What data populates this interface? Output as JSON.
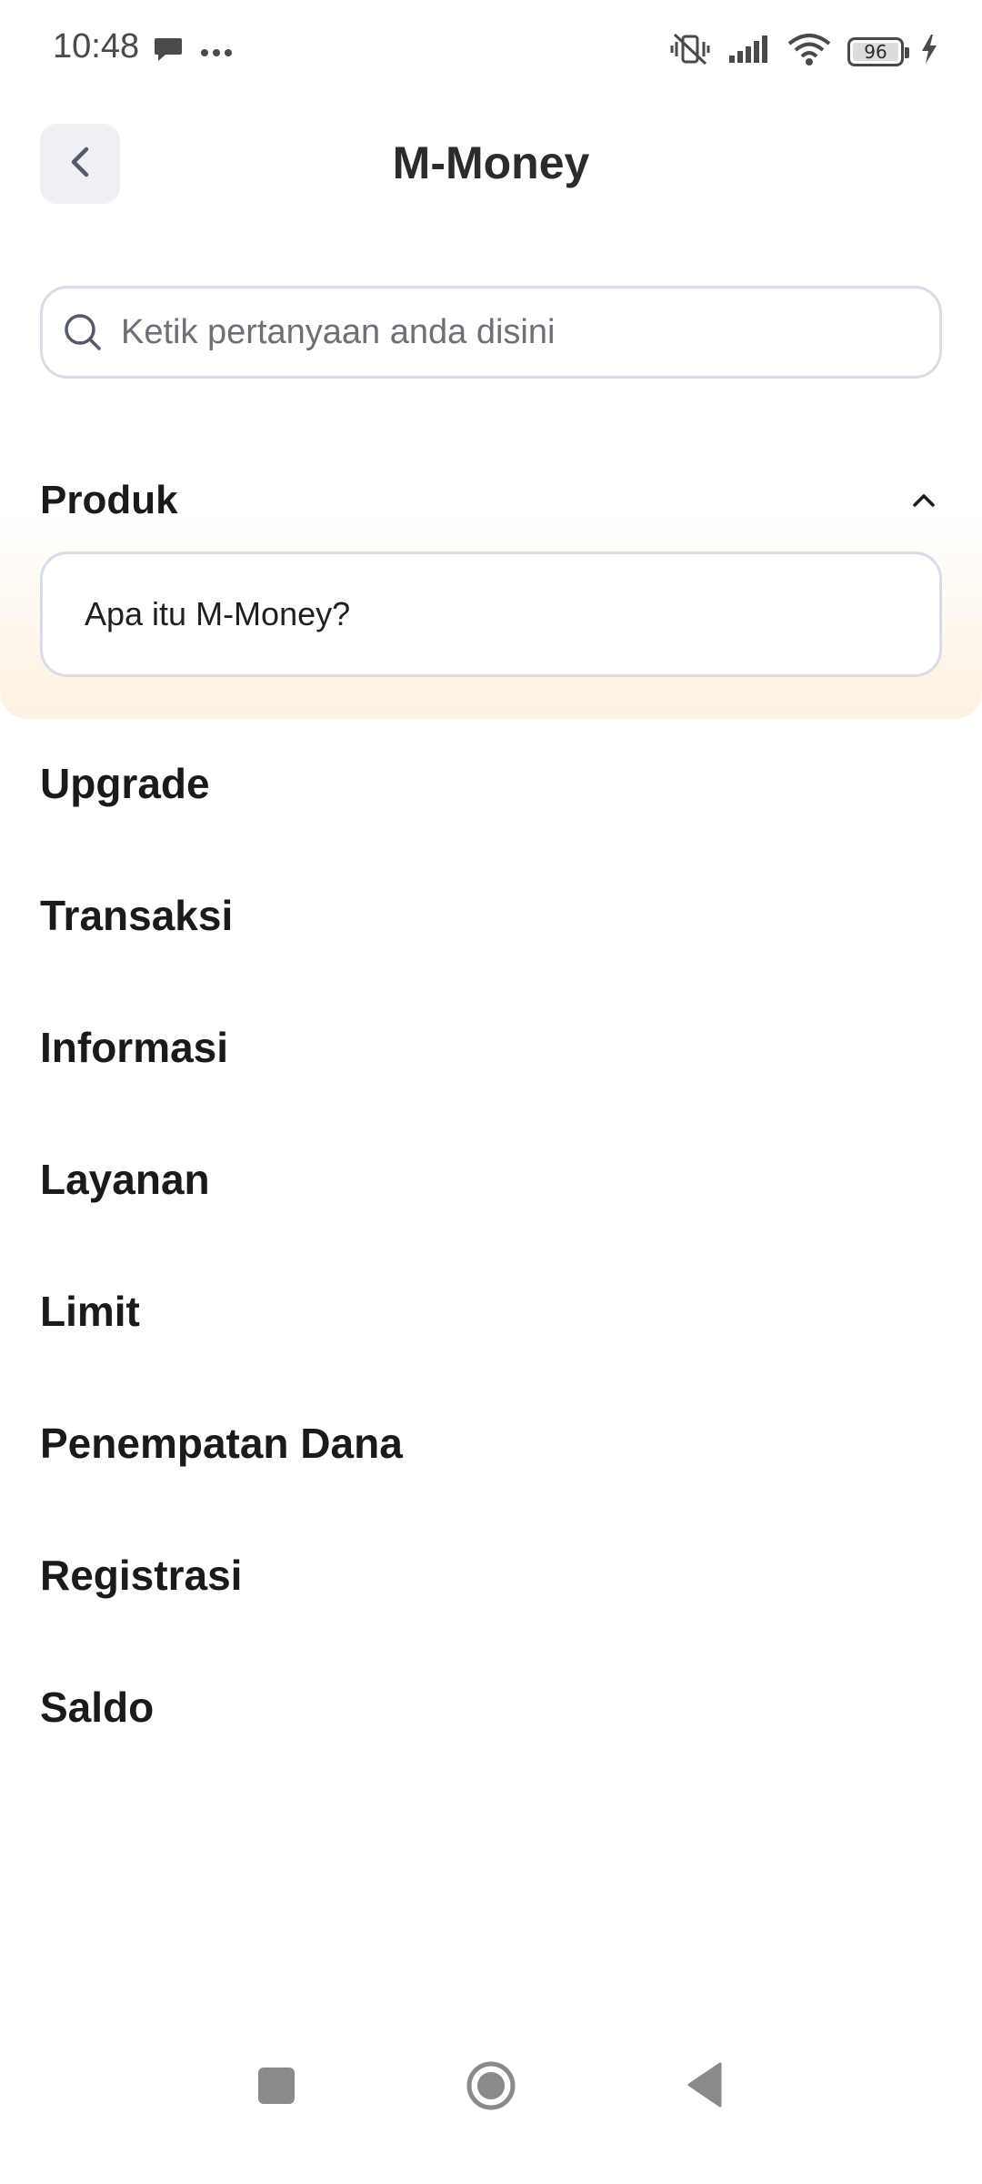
{
  "status_bar": {
    "time": "10:48",
    "battery": "96",
    "icons": [
      "chat-bubble-icon",
      "more-dots-icon",
      "vibrate-off-icon",
      "signal-icon",
      "wifi-icon",
      "battery-icon",
      "charging-icon"
    ]
  },
  "header": {
    "title": "M-Money",
    "back_icon": "chevron-left-icon"
  },
  "search": {
    "placeholder": "Ketik pertanyaan anda disini",
    "value": ""
  },
  "expanded_category": {
    "title": "Produk",
    "icon": "chevron-up-icon",
    "questions": [
      "Apa itu M-Money?"
    ]
  },
  "categories": [
    "Upgrade",
    "Transaksi",
    "Informasi",
    "Layanan",
    "Limit",
    "Penempatan Dana",
    "Registrasi",
    "Saldo"
  ],
  "nav": {
    "icons": [
      "recents-square-icon",
      "home-circle-icon",
      "back-triangle-icon"
    ]
  },
  "colors": {
    "accent_gradient": "#fdf1e1",
    "border": "#d9dce8",
    "back_button_bg": "#eef0f4"
  }
}
